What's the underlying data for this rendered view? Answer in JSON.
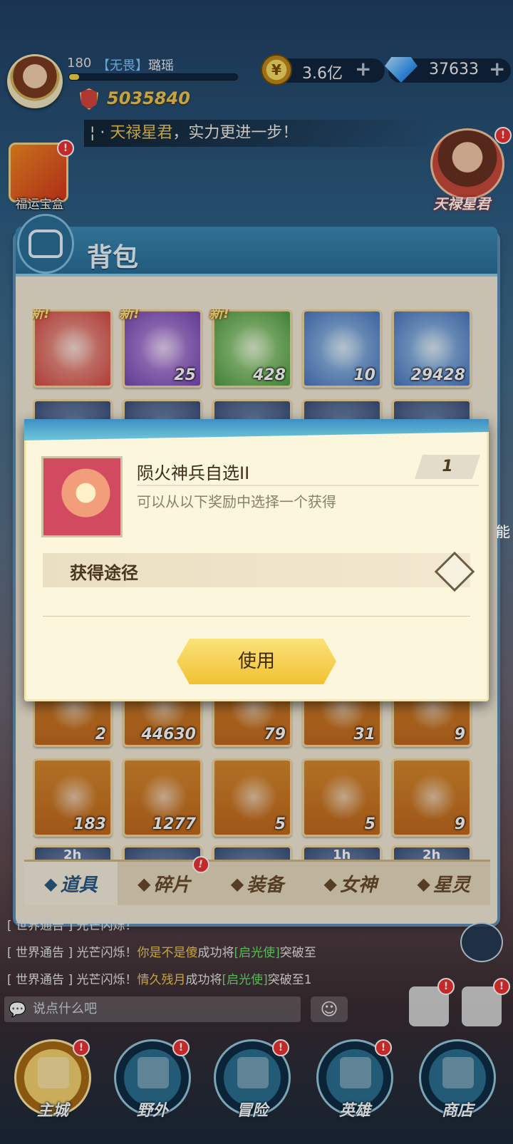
{
  "player": {
    "level": "180",
    "guild_tag": "【无畏】",
    "name": "璐瑶",
    "xp_fraction": 0.06,
    "power": "5035840"
  },
  "resources": {
    "gold": "3.6亿",
    "gems": "37633",
    "plus": "+"
  },
  "marquee": {
    "lead": "¦ · ",
    "highlight": "天禄星君",
    "rest": "，实力更进一步！"
  },
  "side_events": {
    "lucky_box_label": "福运宝盒",
    "star_lord_label": "天禄星君",
    "right_label": "能"
  },
  "badge": "!",
  "backpack": {
    "title": "背包",
    "new_label": "新!",
    "row1": [
      {
        "icon": "fire-orb-icon",
        "color": "red",
        "qty": "",
        "is_new": true
      },
      {
        "icon": "purple-gem-icon",
        "color": "purple",
        "qty": "25",
        "is_new": true
      },
      {
        "icon": "green-crystal-icon",
        "color": "green",
        "qty": "428",
        "is_new": true
      },
      {
        "icon": "rainbow-cube-icon",
        "color": "blue",
        "qty": "10",
        "is_new": false
      },
      {
        "icon": "blue-crystal-icon",
        "color": "blue",
        "qty": "29428",
        "is_new": false
      }
    ],
    "row_hidden": [
      {
        "icon": "item-icon",
        "color": "dark",
        "qty": ""
      },
      {
        "icon": "item-icon",
        "color": "dark",
        "qty": ""
      },
      {
        "icon": "item-icon",
        "color": "dark",
        "qty": ""
      },
      {
        "icon": "item-icon",
        "color": "dark",
        "qty": ""
      },
      {
        "icon": "item-icon",
        "color": "dark",
        "qty": ""
      }
    ],
    "row4": [
      {
        "icon": "card-icon",
        "qty": "2"
      },
      {
        "icon": "ore-icon",
        "qty": "44630"
      },
      {
        "icon": "red-wheel-icon",
        "qty": "79"
      },
      {
        "icon": "gold-wheel-icon",
        "qty": "31"
      },
      {
        "icon": "blue-wheel-icon",
        "qty": "9"
      }
    ],
    "row5": [
      {
        "icon": "shard-icon",
        "qty": "183"
      },
      {
        "icon": "scroll-tube-icon",
        "qty": "1277"
      },
      {
        "icon": "hexagram-scroll-icon",
        "qty": "5"
      },
      {
        "icon": "void-gem-icon",
        "qty": "5"
      },
      {
        "icon": "parchment-icon",
        "qty": "9"
      }
    ],
    "row6_timers": [
      "2h",
      "",
      "1h",
      "2h"
    ],
    "tabs": [
      {
        "label": "道具",
        "icon": "props-icon"
      },
      {
        "label": "碎片",
        "icon": "fragment-icon"
      },
      {
        "label": "装备",
        "icon": "equipment-icon"
      },
      {
        "label": "女神",
        "icon": "goddess-icon"
      },
      {
        "label": "星灵",
        "icon": "star-spirit-icon"
      }
    ]
  },
  "modal": {
    "item_name": "陨火神兵自选II",
    "count": "1",
    "description": "可以从以下奖励中选择一个获得",
    "source_label": "获得途径",
    "use_button": "使用"
  },
  "chat": {
    "lines": [
      {
        "prefix": "[ 世界通告 ] 光芒闪烁！",
        "player": "",
        "mid": "",
        "hero": "",
        "tail": ""
      },
      {
        "prefix": "[ 世界通告 ] 光芒闪烁！",
        "player": "你是不是傻",
        "mid": "成功将",
        "hero": "[启光使]",
        "tail": "突破至"
      },
      {
        "prefix": "[ 世界通告 ] 光芒闪烁！",
        "player": "情久残月",
        "mid": "成功将",
        "hero": "[启光使]",
        "tail": "突破至1"
      }
    ],
    "input_placeholder": "说点什么吧",
    "emoji_glyph": "☺"
  },
  "nav": [
    {
      "label": "主城",
      "active": true
    },
    {
      "label": "野外",
      "active": false
    },
    {
      "label": "冒险",
      "active": false
    },
    {
      "label": "英雄",
      "active": false
    },
    {
      "label": "商店",
      "active": false
    }
  ]
}
